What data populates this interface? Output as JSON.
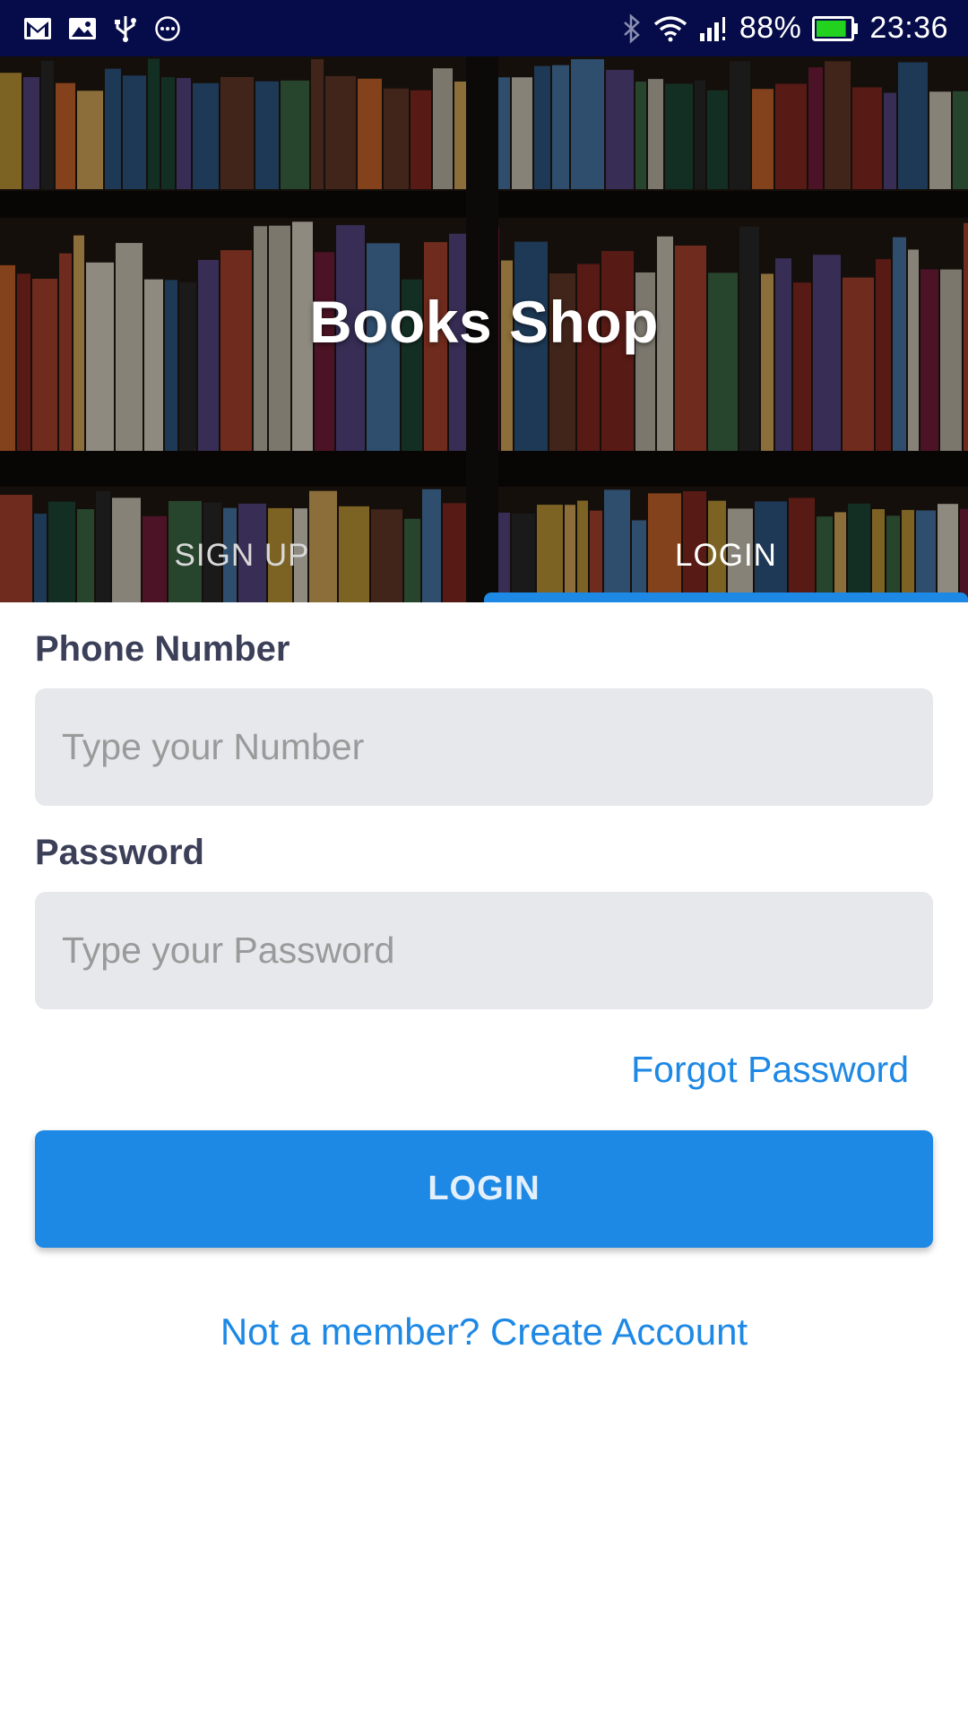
{
  "status_bar": {
    "battery_percent": "88%",
    "time": "23:36",
    "battery_level": 0.88,
    "background": "#060b4a",
    "icons_left": [
      "gmail-icon",
      "gallery-icon",
      "usb-icon",
      "more-icon"
    ],
    "icons_right": [
      "bluetooth-icon",
      "wifi-icon",
      "signal-icon",
      "battery-icon"
    ]
  },
  "header": {
    "title": "Books Shop",
    "background": "bookshelf-photo"
  },
  "tabs": [
    {
      "label": "SIGN UP",
      "selected": false
    },
    {
      "label": "LOGIN",
      "selected": true
    }
  ],
  "form": {
    "phone_label": "Phone Number",
    "phone_placeholder": "Type your Number",
    "password_label": "Password",
    "password_placeholder": "Type your Password",
    "forgot_password": "Forgot Password",
    "login_button": "LOGIN",
    "create_account": "Not a member? Create Account"
  },
  "colors": {
    "accent": "#1e88e5",
    "label": "#3b3f58",
    "input_background": "#e6e8eb"
  }
}
